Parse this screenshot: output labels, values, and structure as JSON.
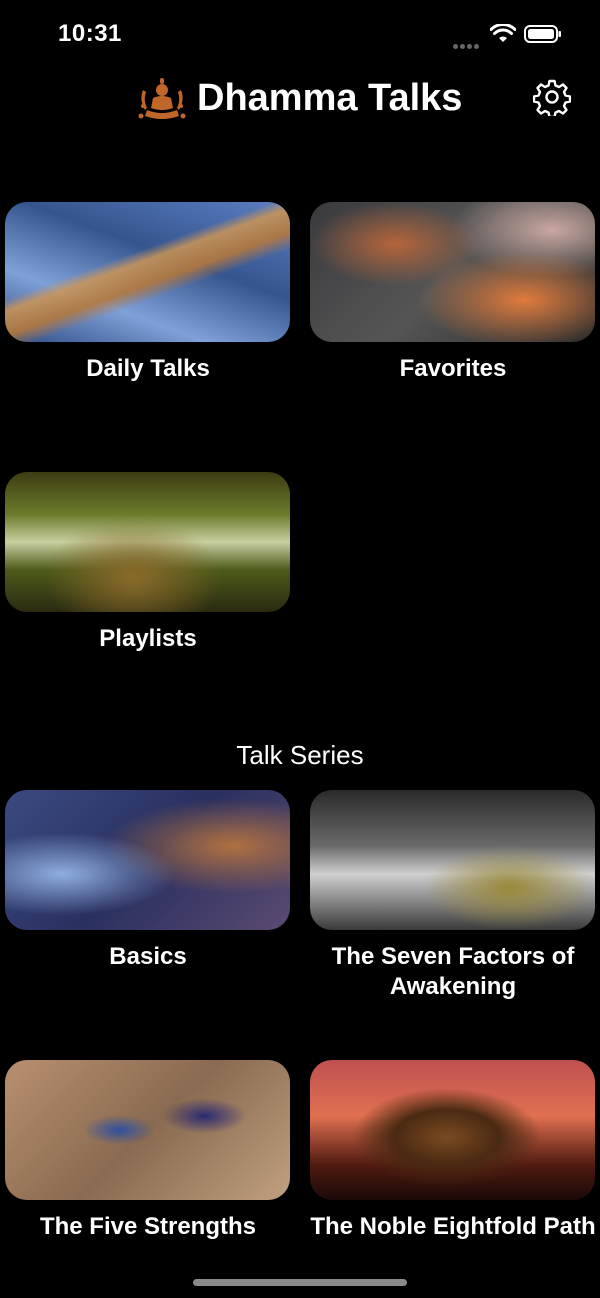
{
  "status_bar": {
    "time": "10:31",
    "icons": [
      "signal-dots-icon",
      "wifi-icon",
      "battery-icon"
    ]
  },
  "header": {
    "title": "Dhamma Talks",
    "logo_icon": "buddha-logo-icon",
    "settings_icon": "gear-icon",
    "accent_color": "#c0662a"
  },
  "main_tiles": [
    {
      "label": "Daily Talks"
    },
    {
      "label": "Favorites"
    },
    {
      "label": "Playlists"
    }
  ],
  "talk_series": {
    "title": "Talk Series",
    "items": [
      {
        "label": "Basics"
      },
      {
        "label": "The Seven Factors of Awakening"
      },
      {
        "label": "The Five Strengths"
      },
      {
        "label": "The Noble Eightfold Path"
      }
    ]
  }
}
